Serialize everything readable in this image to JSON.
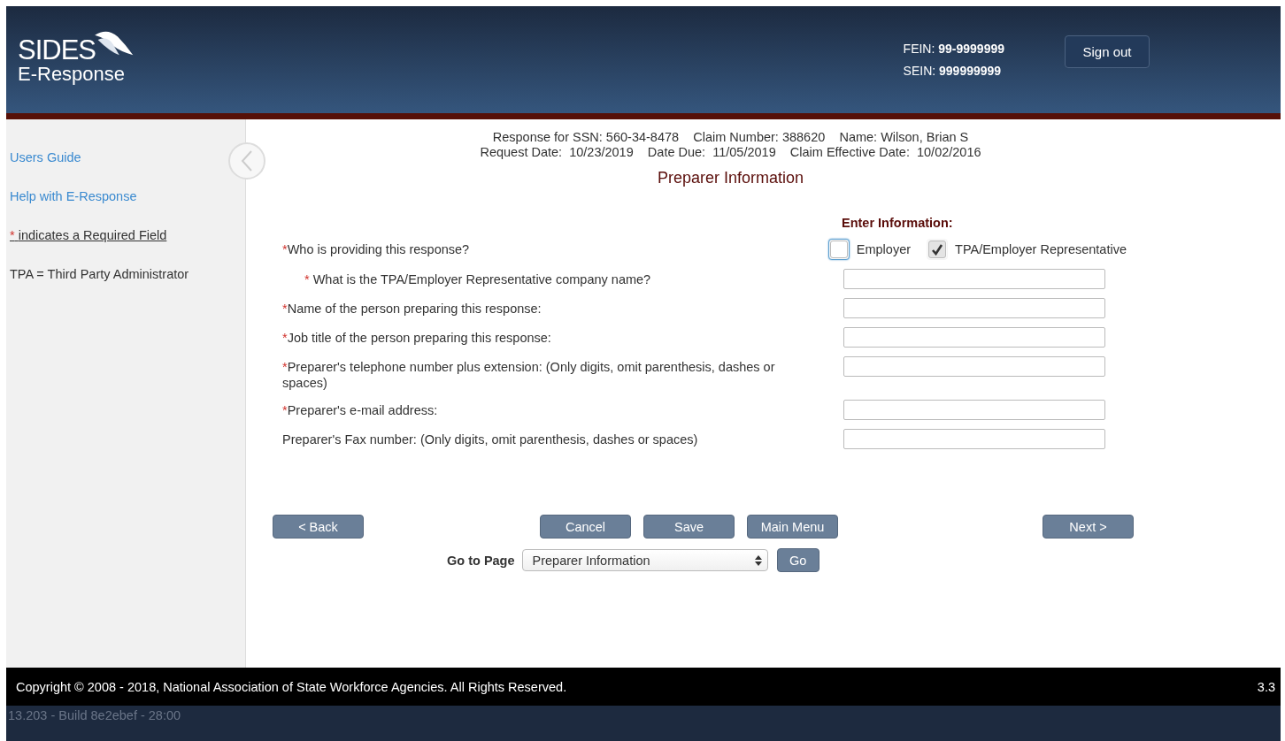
{
  "header": {
    "logo_title": "SIDES",
    "logo_subtitle": "E-Response",
    "ids": [
      "FEIN: **99-9999999**",
      "SEIN: **999999999**"
    ],
    "sign_out": "Sign out"
  },
  "sidebar": {
    "links": [
      "Users Guide",
      "Help with E-Response"
    ],
    "required_note": {
      "marker": "*",
      "text": "indicates a Required Field"
    },
    "legend": "TPA = Third Party Administrator"
  },
  "claim": {
    "lines": [
      "Response for SSN: 560-34-8478    Claim Number: 388620    Name: Wilson, Brian S",
      "Request Date:  10/23/2019    Date Due:  11/05/2019    Claim Effective Date:  10/02/2016"
    ]
  },
  "page_title": "Preparer Information",
  "enter_heading": "Enter Information:",
  "questions": [
    {
      "marker": "*",
      "label": "Who is providing this response?",
      "kind": "choice",
      "options": [
        {
          "label": "Employer",
          "checked": false,
          "focused": true
        },
        {
          "label": "TPA/Employer Representative",
          "checked": true,
          "focused": false
        }
      ],
      "children": [
        {
          "marker": "*",
          "label": "What is the TPA/Employer Representative company name?",
          "kind": "text"
        }
      ]
    },
    {
      "marker": "*",
      "label": "Name of the person preparing this response:",
      "kind": "text"
    },
    {
      "marker": "*",
      "label": "Job title of the person preparing this response:",
      "kind": "text"
    },
    {
      "marker": "*",
      "label": "Preparer's telephone number plus extension: (Only digits, omit parenthesis, dashes or spaces)",
      "kind": "text"
    },
    {
      "marker": "*",
      "label": "Preparer's e-mail address:",
      "kind": "text"
    },
    {
      "label": "Preparer's Fax number: (Only digits, omit parenthesis, dashes or spaces)",
      "kind": "text"
    }
  ],
  "buttons": {
    "back": "< Back",
    "middle": [
      "Cancel",
      "Save",
      "Main Menu"
    ],
    "next": "Next >"
  },
  "goto": {
    "label": "Go to Page",
    "value": "Preparer Information",
    "button": "Go"
  },
  "footer": {
    "copyright": "Copyright © 2008 - 2018, National Association of State Workforce Agencies. All Rights Reserved.",
    "version": "3.3",
    "build": "13.203 - Build 8e2ebef - 28:00"
  }
}
